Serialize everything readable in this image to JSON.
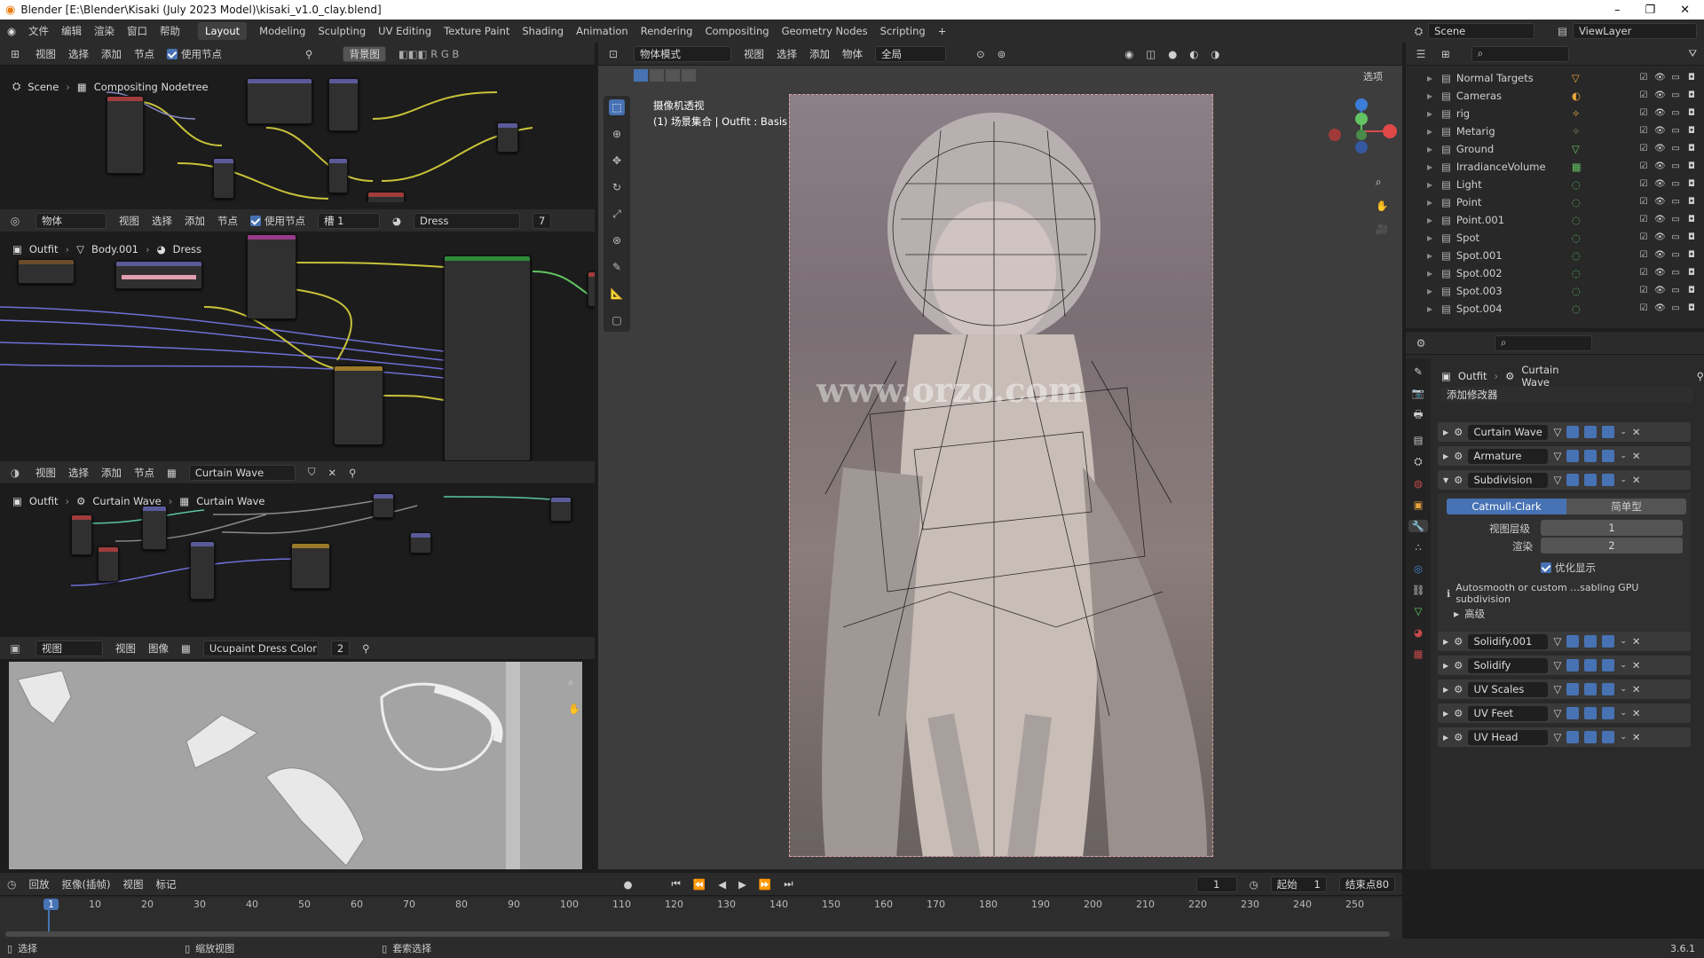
{
  "window": {
    "title": "Blender [E:\\Blender\\Kisaki (July 2023 Model)\\kisaki_v1.0_clay.blend]",
    "controls": [
      "–",
      "❐",
      "✕"
    ]
  },
  "menu": [
    "文件",
    "编辑",
    "渲染",
    "窗口",
    "帮助"
  ],
  "workspaces": [
    "Layout",
    "Modeling",
    "Sculpting",
    "UV Editing",
    "Texture Paint",
    "Shading",
    "Animation",
    "Rendering",
    "Compositing",
    "Geometry Nodes",
    "Scripting",
    "+"
  ],
  "active_workspace": "Layout",
  "scene": {
    "name": "Scene",
    "viewlayer": "ViewLayer"
  },
  "compositor": {
    "menus": [
      "视图",
      "选择",
      "添加",
      "节点"
    ],
    "use_nodes": "使用节点",
    "bg": "背景图",
    "breadcrumb_scene": "Scene",
    "breadcrumb_tree": "Compositing Nodetree"
  },
  "shader": {
    "mode": "物体",
    "menus": [
      "视图",
      "选择",
      "添加",
      "节点"
    ],
    "use_nodes": "使用节点",
    "slot": "槽 1",
    "material": "Dress",
    "users": "7",
    "bc_object": "Outfit",
    "bc_mesh": "Body.001",
    "bc_mat": "Dress"
  },
  "geonodes": {
    "menus": [
      "视图",
      "选择",
      "添加",
      "节点"
    ],
    "tree": "Curtain Wave",
    "bc_object": "Outfit",
    "bc_mod": "Curtain Wave",
    "bc_tree": "Curtain Wave"
  },
  "image_editor": {
    "mode": "视图",
    "menus": [
      "视图",
      "图像"
    ],
    "image": "Ucupaint Dress Color",
    "users": "2"
  },
  "viewport": {
    "mode": "物体模式",
    "menus": [
      "视图",
      "选择",
      "添加",
      "物体"
    ],
    "transform": "全局",
    "options": "选项",
    "overlay_title": "摄像机透视",
    "overlay_sub": "(1) 场景集合 | Outfit : Basis",
    "watermark": "www.orzo.com"
  },
  "outliner": {
    "items": [
      {
        "name": "Normal Targets",
        "icon": "▽",
        "color": "#e8a33c"
      },
      {
        "name": "Cameras",
        "icon": "◐",
        "color": "#e8a33c"
      },
      {
        "name": "rig",
        "icon": "✧",
        "color": "#e8a33c"
      },
      {
        "name": "Metarig",
        "icon": "✧",
        "color": "#8a7a5a"
      },
      {
        "name": "Ground",
        "icon": "▽",
        "color": "#62c462"
      },
      {
        "name": "IrradianceVolume",
        "icon": "▦",
        "color": "#62c462"
      },
      {
        "name": "Light",
        "icon": "◌",
        "color": "#62c462"
      },
      {
        "name": "Point",
        "icon": "◌",
        "color": "#62c462"
      },
      {
        "name": "Point.001",
        "icon": "◌",
        "color": "#62c462"
      },
      {
        "name": "Spot",
        "icon": "◌",
        "color": "#62c462"
      },
      {
        "name": "Spot.001",
        "icon": "◌",
        "color": "#62c462"
      },
      {
        "name": "Spot.002",
        "icon": "◌",
        "color": "#62c462"
      },
      {
        "name": "Spot.003",
        "icon": "◌",
        "color": "#62c462"
      },
      {
        "name": "Spot.004",
        "icon": "◌",
        "color": "#62c462"
      }
    ]
  },
  "properties": {
    "bc_object": "Outfit",
    "bc_mod": "Curtain Wave",
    "add_modifier": "添加修改器",
    "modifiers_top": [
      "Curtain Wave",
      "Armature",
      "Subdivision"
    ],
    "subdiv": {
      "tab1": "Catmull-Clark",
      "tab2": "简单型",
      "viewport_label": "视图层级",
      "viewport_val": "1",
      "render_label": "渲染",
      "render_val": "2",
      "opt_label": "优化显示",
      "info": "Autosmooth or custom …sabling GPU subdivision",
      "advanced": "高级"
    },
    "modifiers_bottom": [
      "Solidify.001",
      "Solidify",
      "UV Scales",
      "UV Feet",
      "UV Head"
    ]
  },
  "timeline": {
    "menus": [
      "回放",
      "抠像(插帧)",
      "视图",
      "标记"
    ],
    "current": "1",
    "start_label": "起始",
    "start": "1",
    "end_label": "结束点",
    "end": "80",
    "ticks": [
      "1",
      "10",
      "20",
      "30",
      "40",
      "50",
      "60",
      "70",
      "80",
      "90",
      "100",
      "110",
      "120",
      "130",
      "140",
      "150",
      "160",
      "170",
      "180",
      "190",
      "200",
      "210",
      "220",
      "230",
      "240",
      "250"
    ]
  },
  "status": {
    "left": "选择",
    "mid": "缩放视图",
    "right": "套索选择",
    "version": "3.6.1"
  }
}
